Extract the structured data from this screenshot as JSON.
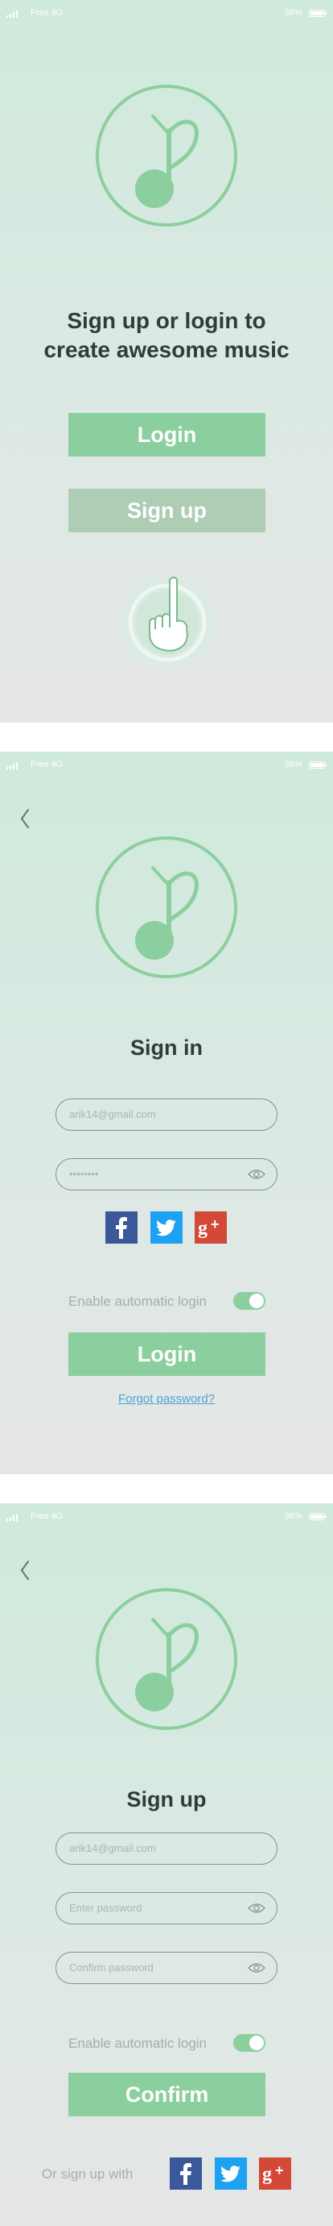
{
  "status_bar": {
    "carrier": "Free  4G",
    "battery": "98%"
  },
  "colors": {
    "accent": "#8ccf9e",
    "button_secondary": "#aecdb5",
    "background_top": "#cfe9dc",
    "background_bottom": "#e5e6e7",
    "title_text": "#333b3a",
    "link": "#4aa4d8",
    "facebook": "#3b5998",
    "twitter": "#1da1f2",
    "google_plus": "#d34836"
  },
  "welcome": {
    "headline_line1": "Sign up or login to",
    "headline_line2": "create awesome music",
    "login_label": "Login",
    "signup_label": "Sign up",
    "icons": [
      "music-note-icon",
      "hand-pointer-icon"
    ]
  },
  "signin": {
    "title": "Sign in",
    "email_value": "arik14@gmail.com",
    "password_value": "••••••••",
    "social": [
      "facebook-icon",
      "twitter-icon",
      "google-plus-icon"
    ],
    "auto_login_label": "Enable automatic login",
    "auto_login_on": true,
    "login_label": "Login",
    "forgot_label": "Forgot password?"
  },
  "signup": {
    "title": "Sign up",
    "email_value": "arik14@gmail.com",
    "password_placeholder": "Enter password",
    "confirm_placeholder": "Confirm password",
    "auto_login_label": "Enable automatic login",
    "auto_login_on": true,
    "confirm_label": "Confirm",
    "social_prompt": "Or sign up with",
    "social": [
      "facebook-icon",
      "twitter-icon",
      "google-plus-icon"
    ]
  }
}
